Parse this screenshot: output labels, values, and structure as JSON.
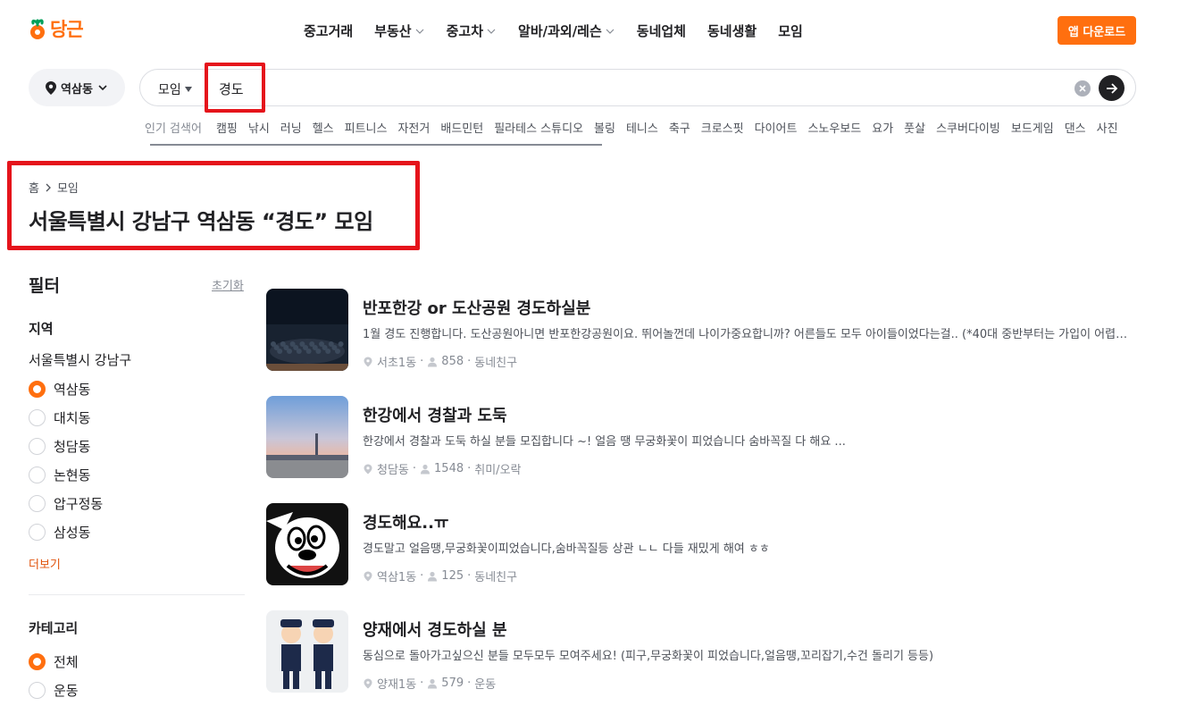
{
  "header": {
    "logo_text": "당근",
    "nav": [
      {
        "label": "중고거래",
        "has_chevron": false
      },
      {
        "label": "부동산",
        "has_chevron": true
      },
      {
        "label": "중고차",
        "has_chevron": true
      },
      {
        "label": "알바/과외/레슨",
        "has_chevron": true
      },
      {
        "label": "동네업체",
        "has_chevron": false
      },
      {
        "label": "동네생활",
        "has_chevron": false
      },
      {
        "label": "모임",
        "has_chevron": false
      }
    ],
    "download_label": "앱 다운로드",
    "accent_color": "#ff6f0f"
  },
  "search": {
    "location": "역삼동",
    "category": "모임",
    "query": "경도",
    "popular_label": "인기 검색어",
    "popular": [
      "캠핑",
      "낚시",
      "러닝",
      "헬스",
      "피트니스",
      "자전거",
      "배드민턴",
      "필라테스 스튜디오",
      "볼링",
      "테니스",
      "축구",
      "크로스핏",
      "다이어트",
      "스노우보드",
      "요가",
      "풋살",
      "스쿠버다이빙",
      "보드게임",
      "댄스",
      "사진"
    ]
  },
  "breadcrumb": {
    "home": "홈",
    "current": "모임"
  },
  "page_title": "서울특별시 강남구 역삼동 “경도” 모임",
  "filter": {
    "title": "필터",
    "reset": "초기화",
    "region_title": "지역",
    "region_parent": "서울특별시 강남구",
    "regions": [
      {
        "label": "역삼동",
        "selected": true
      },
      {
        "label": "대치동",
        "selected": false
      },
      {
        "label": "청담동",
        "selected": false
      },
      {
        "label": "논현동",
        "selected": false
      },
      {
        "label": "압구정동",
        "selected": false
      },
      {
        "label": "삼성동",
        "selected": false
      }
    ],
    "more": "더보기",
    "category_title": "카테고리",
    "categories": [
      {
        "label": "전체",
        "selected": true
      },
      {
        "label": "운동",
        "selected": false
      }
    ]
  },
  "results": [
    {
      "title": "반포한강 or 도산공원 경도하실분",
      "desc": "1월 경도 진행합니다. 도산공원아니면 반포한강공원이요. 뛰어놀껀데 나이가중요합니까? 어른들도 모두 아이들이었다는걸.. (*40대 중반부터는 가입이 어렵습니다)",
      "area": "서초1동",
      "members": "858",
      "category": "동네친구",
      "thumb": "group-photo-night"
    },
    {
      "title": "한강에서 경찰과 도둑",
      "desc": "한강에서 경찰과 도둑 하실 분들 모집합니다 ~! 얼음 땡 무궁화꽃이 피었습니다 숨바꼭질 다 해요 ...",
      "area": "청담동",
      "members": "1548",
      "category": "취미/오락",
      "thumb": "han-river-sunset"
    },
    {
      "title": "경도해요..ㅠ",
      "desc": "경도말고 얼음땡,무궁화꽃이피었습니다,숨바꼭질등 상관 ㄴㄴ 다들 재밌게 해여 ㅎㅎ",
      "area": "역삼1동",
      "members": "125",
      "category": "동네친구",
      "thumb": "cartoon-face"
    },
    {
      "title": "양재에서 경도하실 분",
      "desc": "동심으로 돌아가고싶으신 분들 모두모두 모여주세요! (피구,무궁화꽃이 피었습니다,얼음땡,꼬리잡기,수건 돌리기 등등)",
      "area": "양재1동",
      "members": "579",
      "category": "운동",
      "thumb": "police-illustration"
    }
  ]
}
